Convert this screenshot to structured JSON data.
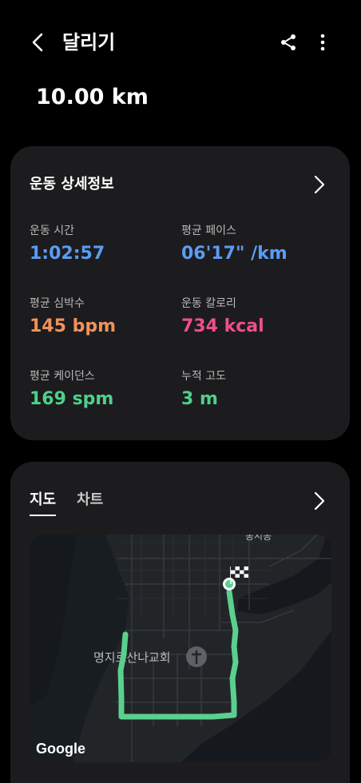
{
  "header": {
    "title": "달리기",
    "distance": "10.00 km"
  },
  "details": {
    "title": "운동 상세정보",
    "stats": [
      {
        "label": "운동 시간",
        "value": "1:02:57",
        "color": "#5b9cf3"
      },
      {
        "label": "평균 페이스",
        "value": "06'17\" /km",
        "color": "#5b9cf3"
      },
      {
        "label": "평균 심박수",
        "value": "145 bpm",
        "color": "#f0925b"
      },
      {
        "label": "운동 칼로리",
        "value": "734 kcal",
        "color": "#ef4f8b"
      },
      {
        "label": "평균 케이던스",
        "value": "169 spm",
        "color": "#4fd08a"
      },
      {
        "label": "누적 고도",
        "value": "3 m",
        "color": "#4fd08a"
      }
    ]
  },
  "map_card": {
    "tabs": [
      {
        "label": "지도",
        "active": true
      },
      {
        "label": "차트",
        "active": false
      }
    ],
    "map": {
      "place_label": "명지로산나교회",
      "road_label_top": "동시동",
      "attribution": "Google",
      "route_color": "#5ad08f"
    }
  },
  "icons": {
    "back": "back-arrow-icon",
    "share": "share-icon",
    "more": "more-vertical-icon",
    "chevron": "chevron-right-icon"
  }
}
